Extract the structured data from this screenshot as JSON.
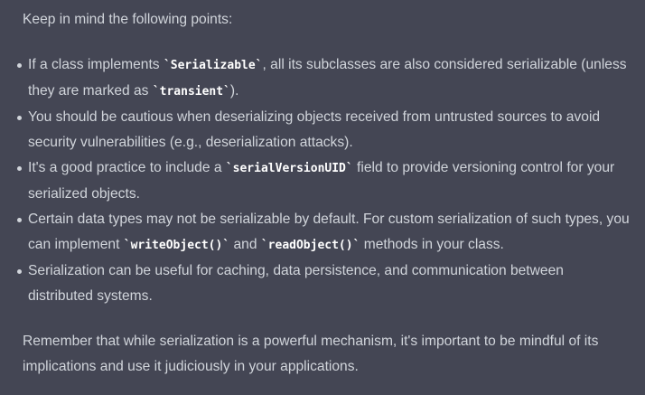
{
  "message": {
    "intro": "Keep in mind the following points:",
    "points": [
      {
        "before": "If a class implements ",
        "code1": "`Serializable`",
        "middle": ", all its subclasses are also considered serializable (unless they are marked as ",
        "code2": "`transient`",
        "after": ")."
      },
      {
        "text": "You should be cautious when deserializing objects received from untrusted sources to avoid security vulnerabilities (e.g., deserialization attacks)."
      },
      {
        "before": "It's a good practice to include a ",
        "code1": "`serialVersionUID`",
        "after": " field to provide versioning control for your serialized objects."
      },
      {
        "before": "Certain data types may not be serializable by default. For custom serialization of such types, you can implement ",
        "code1": "`writeObject()`",
        "middle": " and ",
        "code2": "`readObject()`",
        "after": " methods in your class."
      },
      {
        "text": "Serialization can be useful for caching, data persistence, and communication between distributed systems."
      }
    ],
    "closing": "Remember that while serialization is a powerful mechanism, it's important to be mindful of its implications and use it judiciously in your applications."
  }
}
